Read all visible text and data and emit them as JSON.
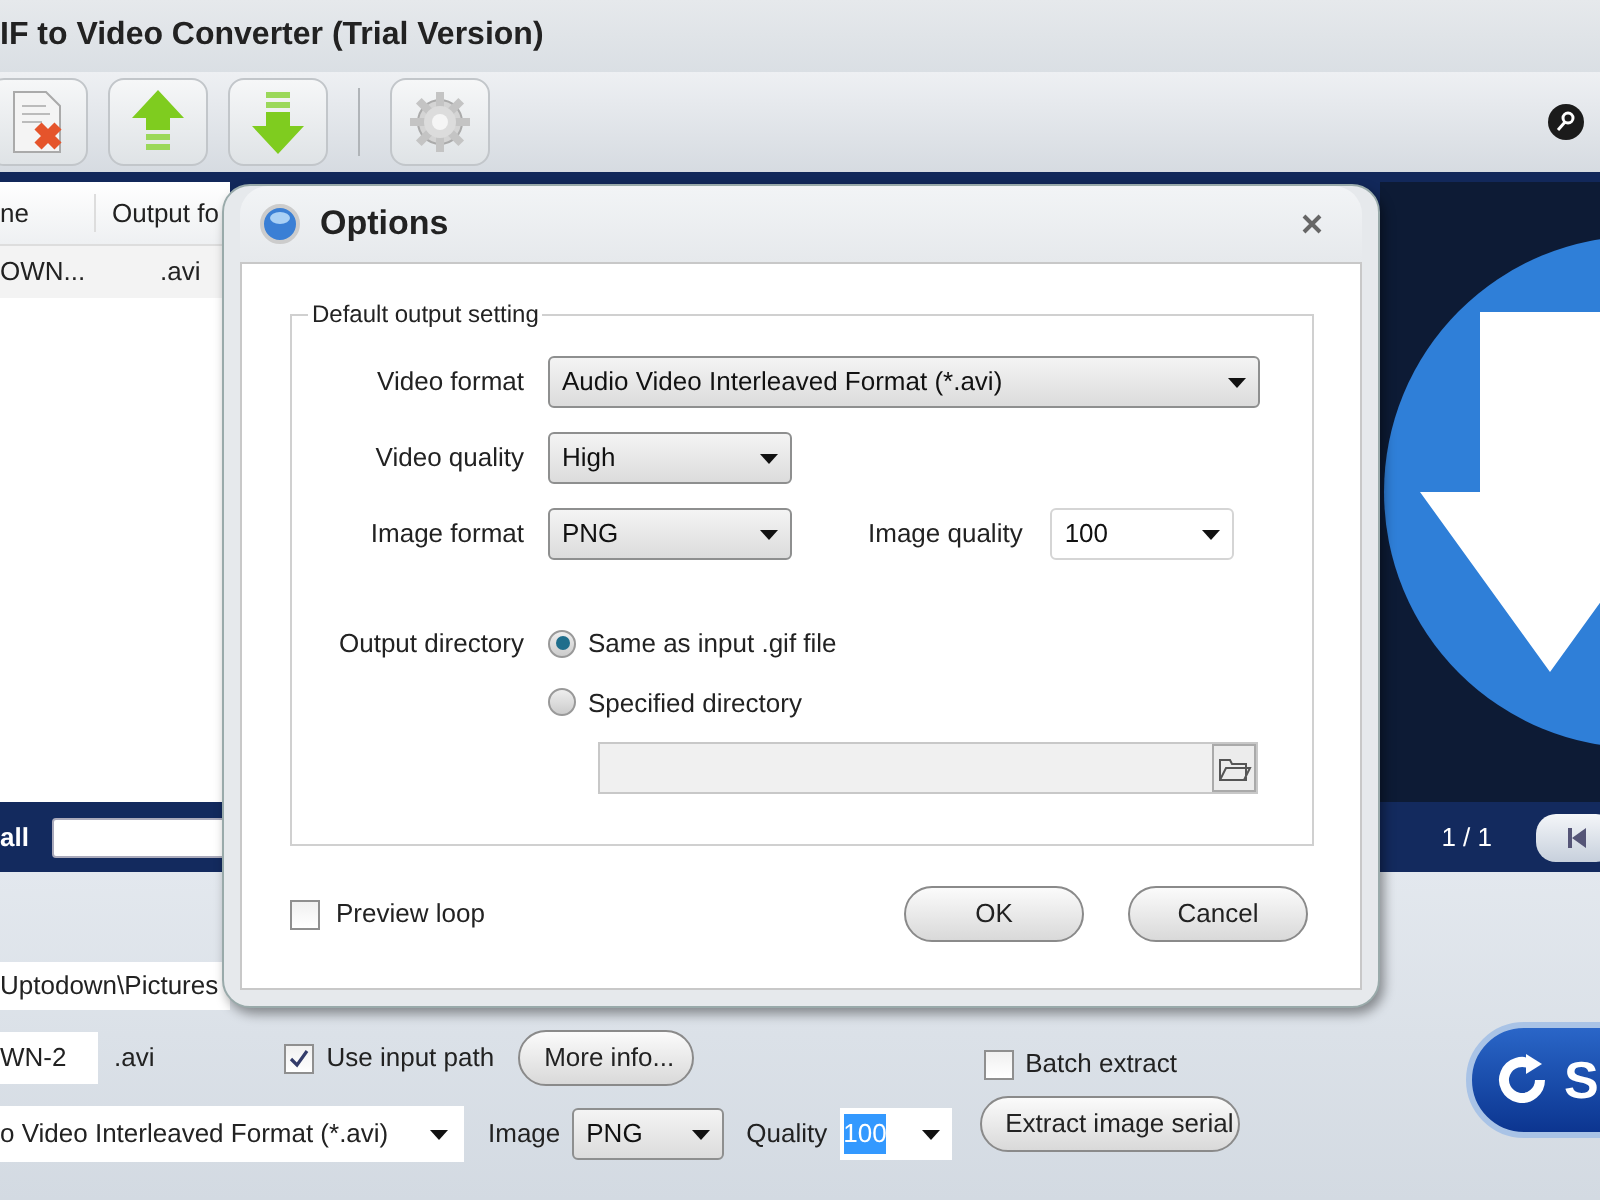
{
  "window": {
    "title": "IF to Video Converter (Trial Version)"
  },
  "toolbar": {
    "buttons": [
      {
        "kind": "remove"
      },
      {
        "kind": "up"
      },
      {
        "kind": "down"
      },
      {
        "kind": "settings"
      }
    ]
  },
  "file_list": {
    "columns": [
      "ne",
      "Output fo"
    ],
    "rows": [
      [
        "OWN...",
        ".avi"
      ]
    ]
  },
  "filter": {
    "label": "all"
  },
  "preview": {
    "counter": "1 / 1"
  },
  "bottom": {
    "path": "Uptodown\\Pictures",
    "name": "WN-2",
    "extension": ".avi",
    "use_input_path": {
      "label": "Use input path",
      "checked": true
    },
    "more_info": "More info...",
    "format": "o Video Interleaved Format (*.avi)",
    "image_label": "Image",
    "image_format": "PNG",
    "quality_label": "Quality",
    "quality": "100",
    "batch_extract": {
      "label": "Batch extract",
      "checked": false
    },
    "extract_button": "Extract image serial",
    "start_button": "S"
  },
  "dialog": {
    "title": "Options",
    "group": "Default output setting",
    "video_format": {
      "label": "Video format",
      "value": "Audio Video Interleaved Format (*.avi)"
    },
    "video_quality": {
      "label": "Video quality",
      "value": "High"
    },
    "image_format": {
      "label": "Image format",
      "value": "PNG"
    },
    "image_quality": {
      "label": "Image quality",
      "value": "100"
    },
    "output_directory": {
      "label": "Output directory",
      "options": [
        {
          "label": "Same as input .gif file",
          "selected": true
        },
        {
          "label": "Specified directory",
          "selected": false
        }
      ]
    },
    "preview_loop": {
      "label": "Preview loop",
      "checked": false
    },
    "buttons": [
      "OK",
      "Cancel"
    ]
  }
}
